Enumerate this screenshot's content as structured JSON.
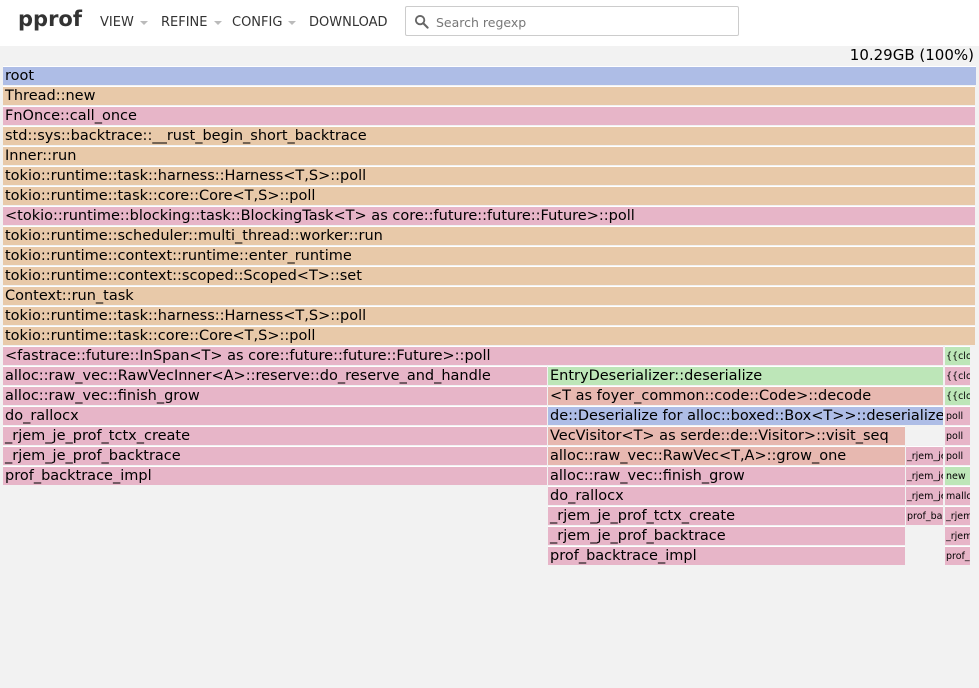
{
  "app": {
    "logo": "pprof",
    "menu": [
      {
        "label": "VIEW",
        "has_caret": true
      },
      {
        "label": "REFINE",
        "has_caret": true
      },
      {
        "label": "CONFIG",
        "has_caret": true
      },
      {
        "label": "DOWNLOAD",
        "has_caret": false
      }
    ],
    "search": {
      "placeholder": "Search regexp",
      "value": ""
    },
    "total": "10.29GB (100%)"
  },
  "colors": {
    "root": "#aebde6",
    "tan": "#e8c9a9",
    "pink": "#e7b5c8",
    "green": "#bde6b8",
    "salmon": "#e7b8b0",
    "blue": "#aebde6"
  },
  "flame": [
    {
      "label": "root",
      "color": "root"
    },
    {
      "label": "Thread::new",
      "color": "tan"
    },
    {
      "label": "FnOnce::call_once",
      "color": "pink"
    },
    {
      "label": "std::sys::backtrace::__rust_begin_short_backtrace",
      "color": "tan"
    },
    {
      "label": "Inner::run",
      "color": "tan"
    },
    {
      "label": "tokio::runtime::task::harness::Harness<T,S>::poll",
      "color": "tan"
    },
    {
      "label": "tokio::runtime::task::core::Core<T,S>::poll",
      "color": "tan"
    },
    {
      "label": "<tokio::runtime::blocking::task::BlockingTask<T> as core::future::future::Future>::poll",
      "color": "pink"
    },
    {
      "label": "tokio::runtime::scheduler::multi_thread::worker::run",
      "color": "tan"
    },
    {
      "label": "tokio::runtime::context::runtime::enter_runtime",
      "color": "tan"
    },
    {
      "label": "tokio::runtime::context::scoped::Scoped<T>::set",
      "color": "tan"
    },
    {
      "label": "Context::run_task",
      "color": "tan"
    },
    {
      "label": "tokio::runtime::task::harness::Harness<T,S>::poll",
      "color": "tan"
    },
    {
      "label": "tokio::runtime::task::core::Core<T,S>::poll",
      "color": "tan"
    },
    {
      "label": "<fastrace::future::InSpan<T> as core::future::future::Future>::poll",
      "color": "pink"
    },
    {
      "label": "alloc::raw_vec::RawVecInner<A>::reserve::do_reserve_and_handle",
      "color": "pink"
    },
    {
      "label": "alloc::raw_vec::finish_grow",
      "color": "pink"
    },
    {
      "label": "do_rallocx",
      "color": "pink"
    },
    {
      "label": "_rjem_je_prof_tctx_create",
      "color": "pink"
    },
    {
      "label": "_rjem_je_prof_backtrace",
      "color": "pink"
    },
    {
      "label": "prof_backtrace_impl",
      "color": "pink"
    },
    {
      "label": "EntryDeserializer::deserialize",
      "color": "green"
    },
    {
      "label": "<T as foyer_common::code::Code>::decode",
      "color": "salmon"
    },
    {
      "label": "de::Deserialize for alloc::boxed::Box<T>>::deserialize",
      "color": "blue"
    },
    {
      "label": "VecVisitor<T> as serde::de::Visitor>::visit_seq",
      "color": "salmon"
    },
    {
      "label": "alloc::raw_vec::RawVec<T,A>::grow_one",
      "color": "salmon"
    },
    {
      "label": "alloc::raw_vec::finish_grow",
      "color": "pink"
    },
    {
      "label": "do_rallocx",
      "color": "pink"
    },
    {
      "label": "_rjem_je_prof_tctx_create",
      "color": "pink"
    },
    {
      "label": "_rjem_je_prof_backtrace",
      "color": "pink"
    },
    {
      "label": "prof_backtrace_impl",
      "color": "pink"
    },
    {
      "label": "_rjem_je_prof_tctx_create",
      "color": "pink"
    },
    {
      "label": "_rjem_je_prof_backtrace",
      "color": "pink"
    },
    {
      "label": "_rjem_je_prof_backtrace",
      "color": "pink"
    },
    {
      "label": "prof_backtrace_impl",
      "color": "pink"
    },
    {
      "label": "{{closure}}",
      "color": "green"
    },
    {
      "label": "{{closure}}",
      "color": "pink"
    },
    {
      "label": "{{closure}}",
      "color": "green"
    },
    {
      "label": "poll",
      "color": "pink"
    },
    {
      "label": "poll",
      "color": "pink"
    },
    {
      "label": "poll",
      "color": "pink"
    },
    {
      "label": "new",
      "color": "green"
    },
    {
      "label": "malloc",
      "color": "pink"
    },
    {
      "label": "_rjem_je_prof_tctx_create",
      "color": "pink"
    },
    {
      "label": "_rjem_je_prof_backtrace",
      "color": "pink"
    },
    {
      "label": "prof_backtrace_impl",
      "color": "pink"
    }
  ]
}
